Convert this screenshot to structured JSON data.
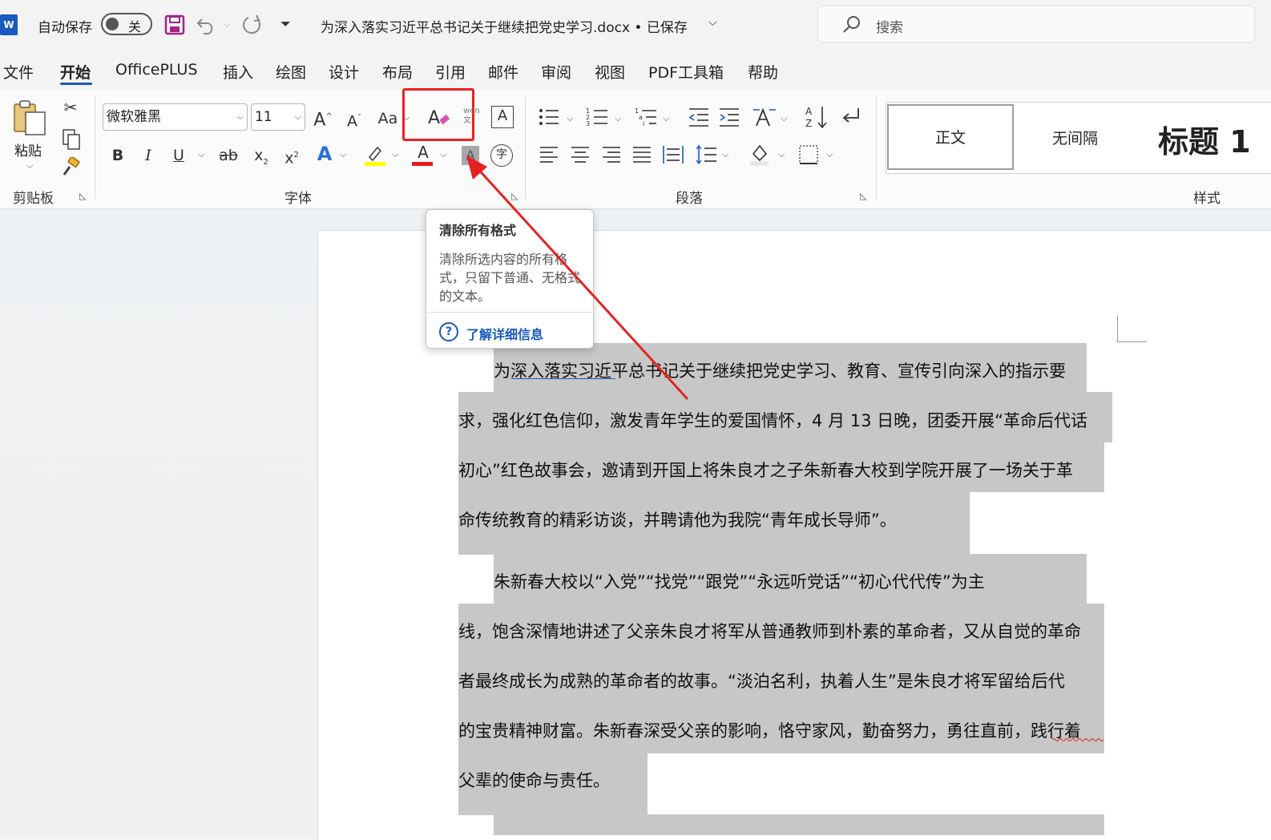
{
  "titlebar": {
    "app_logo": "W",
    "autosave_label": "自动保存",
    "autosave_state": "关",
    "document_title": "为深入落实习近平总书记关于继续把党史学习.docx • 已保存",
    "search_placeholder": "搜索"
  },
  "menu": {
    "tabs": [
      "文件",
      "开始",
      "OfficePLUS",
      "插入",
      "绘图",
      "设计",
      "布局",
      "引用",
      "邮件",
      "审阅",
      "视图",
      "PDF工具箱",
      "帮助"
    ],
    "active_tab": "开始"
  },
  "ribbon": {
    "clipboard": {
      "paste_label": "粘贴",
      "group_label": "剪贴板"
    },
    "font": {
      "font_name": "微软雅黑",
      "font_size": "11",
      "grow_label": "A",
      "shrink_label": "A",
      "case_label": "Aa",
      "bold": "B",
      "italic": "I",
      "underline": "U",
      "strike": "ab",
      "subscript": "x",
      "superscript": "x",
      "effects": "A",
      "highlight_color": "#ffff00",
      "font_color": "#e51c1c",
      "font_color_label": "A",
      "shading_label": "A",
      "phonetic_label": "wén",
      "char_border_label": "A",
      "enclose_label": "字",
      "group_label": "字体"
    },
    "paragraph": {
      "group_label": "段落"
    },
    "styles": {
      "items": [
        "正文",
        "无间隔",
        "标题 1"
      ],
      "group_label": "样式"
    }
  },
  "tooltip": {
    "title": "清除所有格式",
    "body": "清除所选内容的所有格式，只留下普通、无格式的文本。",
    "link": "了解详细信息",
    "help_icon": "?"
  },
  "document": {
    "lines": [
      "为深入落实习近平总书记关于继续把党史学习、教育、宣传引向深入的指示要",
      "求，强化红色信仰，激发青年学生的爱国情怀，4 月 13 日晚，团委开展“革命后代话",
      "初心”红色故事会，邀请到开国上将朱良才之子朱新春大校到学院开展了一场关于革",
      "命传统教育的精彩访谈，并聘请他为我院“青年成长导师”。",
      "朱新春大校以“入党”“找党”“跟党”“永远听党话”“初心代代传”为主",
      "线，饱含深情地讲述了父亲朱良才将军从普通教师到朴素的革命者，又从自觉的革命",
      "者最终成长为成熟的革命者的故事。“淡泊名利，执着人生”是朱良才将军留给后代",
      "的宝贵精神财富。朱新春深受父亲的影响，恪守家风，勤奋努力，勇往直前，践行着",
      "父辈的使命与责任。"
    ]
  },
  "colors": {
    "accent": "#185abd",
    "annotation_red": "#e52222",
    "selection": "#c7c7c7"
  }
}
